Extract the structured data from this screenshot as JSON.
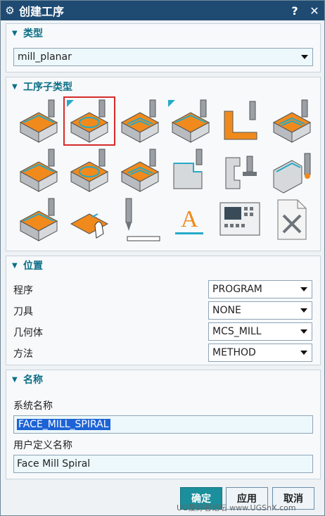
{
  "window": {
    "title": "创建工序",
    "help": "?",
    "close": "✕"
  },
  "type_section": {
    "label": "类型",
    "value": "mill_planar"
  },
  "subtype_section": {
    "label": "工序子类型",
    "icons": [
      "floor-wall-icon",
      "face-mill-spiral-icon",
      "face-mill-icon",
      "face-mill-area-icon",
      "wall-profile-icon",
      "planar-mill-pocket-icon",
      "floor-corner-icon",
      "cavity-mill-icon",
      "floor-wall-is-icon",
      "groove-icon",
      "slot-icon",
      "drill-tool-icon",
      "planar-stack-icon",
      "manual-mill-icon",
      "planar-text-tool-icon",
      "text-icon",
      "machine-control-icon",
      "user-defined-icon"
    ],
    "selected_index": 1
  },
  "location_section": {
    "label": "位置",
    "rows": [
      {
        "label": "程序",
        "value": "PROGRAM"
      },
      {
        "label": "刀具",
        "value": "NONE"
      },
      {
        "label": "几何体",
        "value": "MCS_MILL"
      },
      {
        "label": "方法",
        "value": "METHOD"
      }
    ]
  },
  "name_section": {
    "label": "名称",
    "system_label": "系统名称",
    "system_value": "FACE_MILL_SPIRAL",
    "user_label": "用户定义名称",
    "user_value": "Face Mill Spiral"
  },
  "buttons": {
    "ok": "确定",
    "apply": "应用",
    "cancel": "取消"
  },
  "watermark": "UG爱好者论坛 www.UGSnX.com",
  "colors": {
    "title_bar": "#1f4b73",
    "accent": "#0c6f86",
    "primary_button": "#1b8f9c",
    "selection_outline": "#d62b2b"
  }
}
